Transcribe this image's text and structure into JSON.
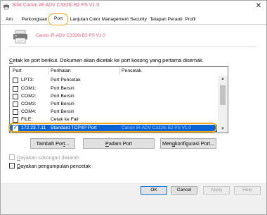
{
  "window": {
    "title": "Sifat Canon iR-ADV C3326i B2 PS V1.0",
    "close_glyph": "✕",
    "accent": "#f2a81d"
  },
  "tabs": [
    "Am",
    "Perkongsian",
    "Port",
    "Lanjutan",
    "Color Management",
    "Security",
    "Tetapan Peranti",
    "Profil"
  ],
  "active_tab": "Port",
  "printer_name": "Canon iR-ADV C3326i B2 PS V1.0",
  "instruction": {
    "first": "C",
    "rest": "etak ke port berikut. Dokumen akan dicetak ke port kosong yang pertama disemak."
  },
  "columns": [
    "Port",
    "Perihalan",
    "Pencetak"
  ],
  "ports": [
    {
      "port": "LPT3:",
      "desc": "Port Pencetak",
      "printer": "",
      "checked": false
    },
    {
      "port": "COM1:",
      "desc": "Port Bersiri",
      "printer": "",
      "checked": false
    },
    {
      "port": "COM2:",
      "desc": "Port Bersiri",
      "printer": "",
      "checked": false
    },
    {
      "port": "COM3:",
      "desc": "Port Bersiri",
      "printer": "",
      "checked": false
    },
    {
      "port": "COM4:",
      "desc": "Port Bersiri",
      "printer": "",
      "checked": false
    },
    {
      "port": "FILE:",
      "desc": "Cetak ke Fail",
      "printer": "",
      "checked": false
    },
    {
      "port": "172.23.7.11",
      "desc": "Standard TCP/IP Port",
      "printer": "Canon iR-ADV C3326i B2 PS V1.0",
      "checked": true,
      "selected": true
    }
  ],
  "buttons": {
    "add": {
      "pre": "Tambah Por",
      "ul": "t",
      "post": "..."
    },
    "delete": {
      "pre": "",
      "ul": "P",
      "post": "adam Port"
    },
    "configure": {
      "pre": "Men",
      "ul": "g",
      "post": "konfigurasi Port..."
    }
  },
  "options": {
    "bidirectional": {
      "ul": "D",
      "rest": "ayakan sokongan dwiarah",
      "checked": false,
      "enabled": false
    },
    "pooling": {
      "ul": "D",
      "rest": "ayakan pengumpulan pencetak",
      "checked": false,
      "enabled": true
    }
  },
  "footer": [
    "OK",
    "Cancel",
    "Apply",
    "Help"
  ]
}
